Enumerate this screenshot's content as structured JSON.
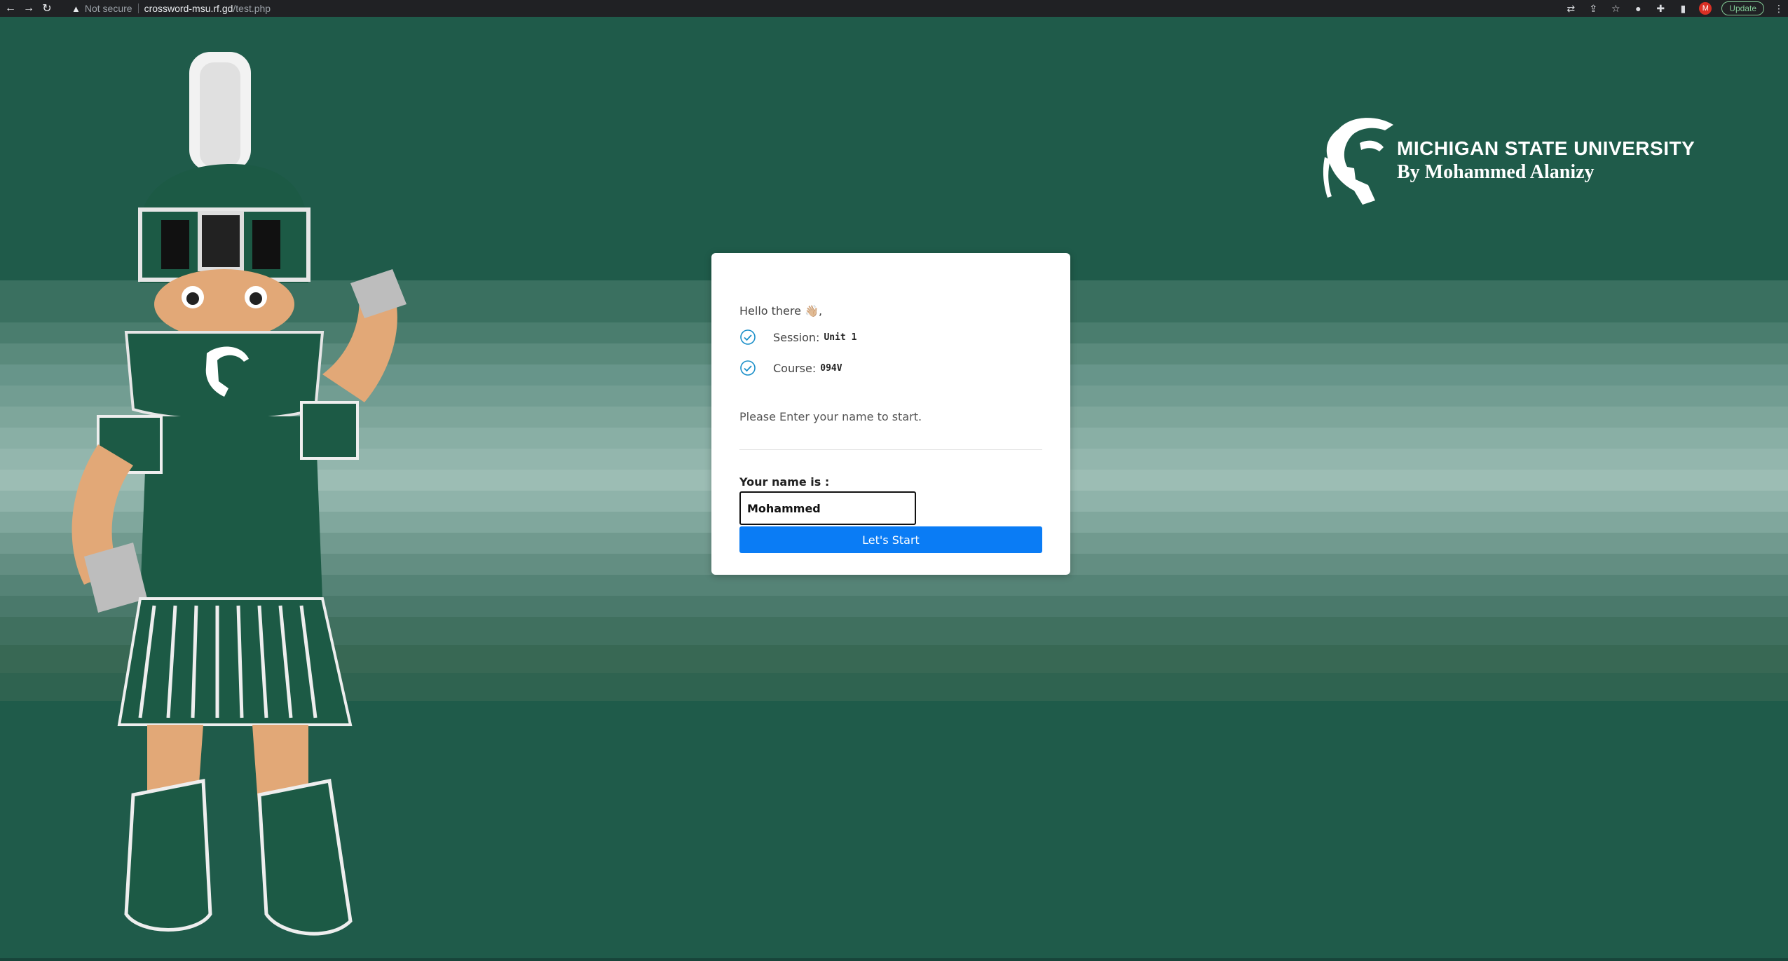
{
  "browser": {
    "security_label": "Not secure",
    "url_host": "crossword-msu.rf.gd",
    "url_path": "/test.php",
    "update_label": "Update",
    "profile_initial": "M"
  },
  "brand": {
    "title": "MICHIGAN STATE UNIVERSITY",
    "subtitle": "By Mohammed Alanizy"
  },
  "card": {
    "greeting": "Hello there 👋🏼,",
    "session_label": "Session:",
    "session_value": "Unit 1",
    "course_label": "Course:",
    "course_value": "094V",
    "instruction": "Please Enter your name to start.",
    "name_label": "Your name is :",
    "name_value": "Mohammed",
    "start_label": "Let's Start"
  },
  "colors": {
    "background": "#1f5b4a",
    "button": "#0a7cf5",
    "check": "#1a8fc9"
  }
}
